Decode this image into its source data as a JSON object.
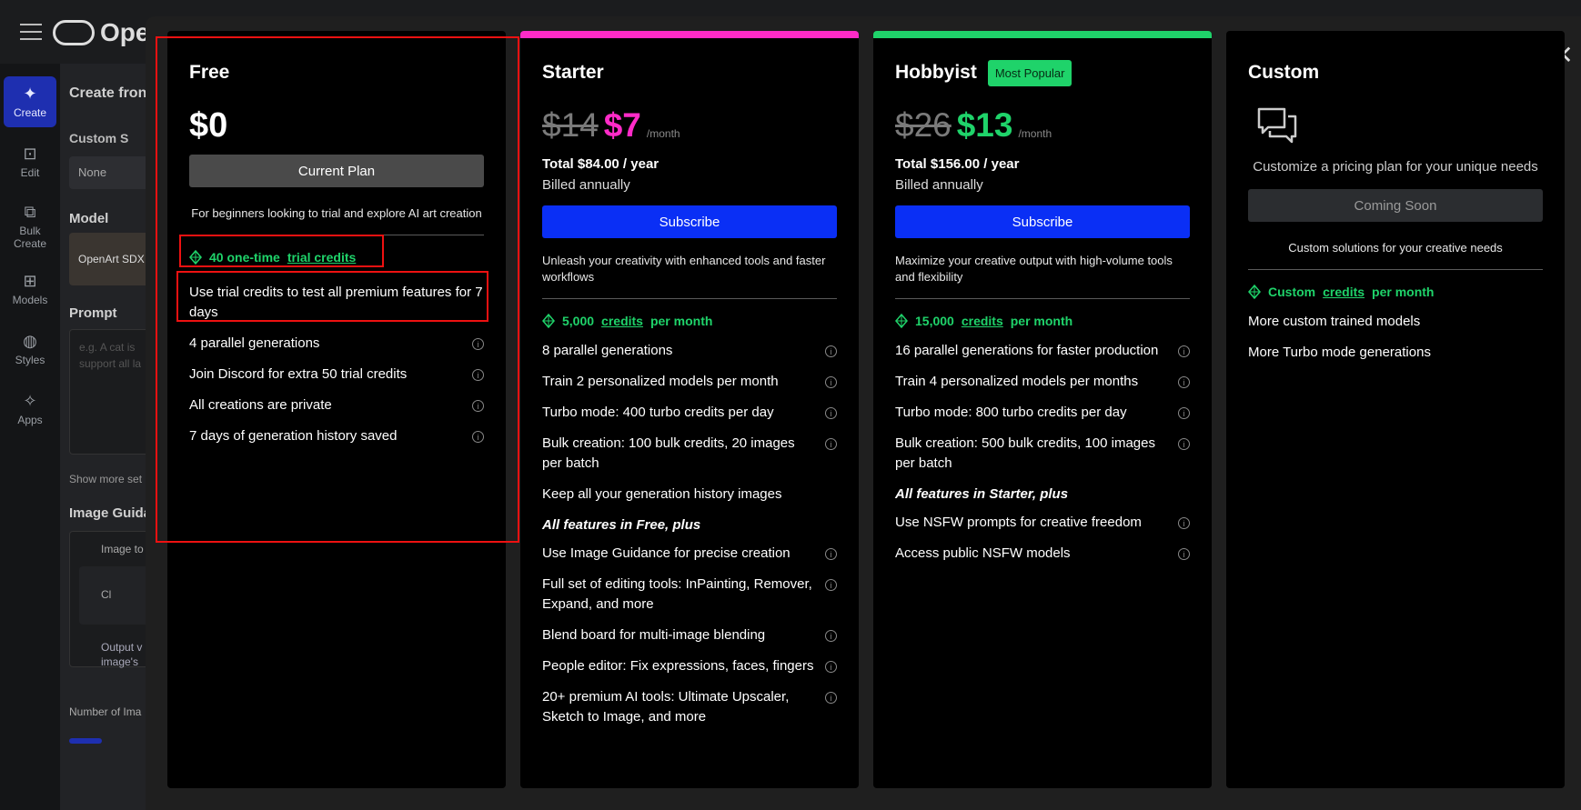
{
  "app": {
    "logo_text": "Ope"
  },
  "nav": [
    {
      "label": "Create",
      "icon": "✦"
    },
    {
      "label": "Edit",
      "icon": "⊡"
    },
    {
      "label": "Bulk\nCreate",
      "icon": "⧉"
    },
    {
      "label": "Models",
      "icon": "⊞"
    },
    {
      "label": "Styles",
      "icon": "◍"
    },
    {
      "label": "Apps",
      "icon": "✧"
    }
  ],
  "side": {
    "title": "Create fron",
    "custom_style": "Custom S",
    "none": "None",
    "model": "Model",
    "model_name": "OpenArt SDX",
    "prompt": "Prompt",
    "prompt_ph": "e.g. A cat is",
    "prompt_ph2": "support all la",
    "show_more": "Show more set",
    "image_guidance": "Image Guida",
    "image_to": "Image to",
    "upload": "Cl",
    "output": "Output v",
    "output2": "image's",
    "num_images": "Number of Ima"
  },
  "plans": {
    "free": {
      "title": "Free",
      "price": "$0",
      "button": "Current Plan",
      "desc": "For beginners looking to trial and explore AI art creation",
      "credits_prefix": "40 one-time",
      "credits_link": "trial credits",
      "features": [
        "Use trial credits to test all premium features for 7 days",
        "4 parallel generations",
        "Join Discord for extra 50 trial credits",
        "All creations are private",
        "7 days of generation history saved"
      ]
    },
    "starter": {
      "title": "Starter",
      "old_price": "$14",
      "new_price": "$7",
      "per": "/month",
      "total": "Total $84.00 / year",
      "billed": "Billed annually",
      "button": "Subscribe",
      "desc": "Unleash your creativity with enhanced tools and faster workflows",
      "credits_prefix": "5,000",
      "credits_link": "credits",
      "credits_suffix": "per month",
      "features": [
        "8 parallel generations",
        "Train 2 personalized models per month",
        "Turbo mode: 400 turbo credits per day",
        "Bulk creation: 100 bulk credits, 20 images per batch",
        "Keep all your generation history images"
      ],
      "section": "All features in Free, plus",
      "features2": [
        "Use Image Guidance for precise creation",
        "Full set of editing tools: InPainting, Remover, Expand, and more",
        "Blend board for multi-image blending",
        "People editor: Fix expressions, faces, fingers",
        "20+ premium AI tools: Ultimate Upscaler, Sketch to Image, and more"
      ]
    },
    "hobbyist": {
      "title": "Hobbyist",
      "badge": "Most Popular",
      "old_price": "$26",
      "new_price": "$13",
      "per": "/month",
      "total": "Total $156.00 / year",
      "billed": "Billed annually",
      "button": "Subscribe",
      "desc": "Maximize your creative output with high-volume tools and flexibility",
      "credits_prefix": "15,000",
      "credits_link": "credits",
      "credits_suffix": "per month",
      "features": [
        "16 parallel generations for faster production",
        "Train 4 personalized models per months",
        "Turbo mode: 800 turbo credits per day",
        "Bulk creation: 500 bulk credits, 100 images per batch"
      ],
      "section": "All features in Starter, plus",
      "features2": [
        "Use NSFW prompts for creative freedom",
        "Access public NSFW models"
      ]
    },
    "custom": {
      "title": "Custom",
      "desc_top": "Customize a pricing plan for your unique needs",
      "button": "Coming Soon",
      "desc": "Custom solutions for your creative needs",
      "credits_prefix": "Custom",
      "credits_link": "credits",
      "credits_suffix": "per month",
      "features": [
        "More custom trained models",
        "More Turbo mode generations"
      ]
    }
  },
  "info_glyph": "i",
  "close_glyph": "✕"
}
